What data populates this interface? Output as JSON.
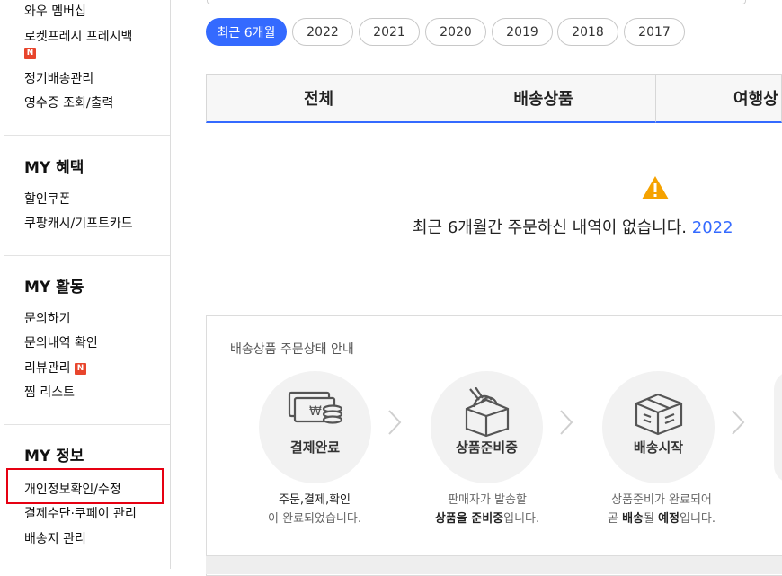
{
  "sidebar": {
    "group1": {
      "items": [
        "와우 멤버십",
        "로켓프레시 프레시백",
        "정기배송관리",
        "영수증 조회/출력"
      ]
    },
    "new_badge": "N",
    "benefits": {
      "title": "MY 혜택",
      "items": [
        "할인쿠폰",
        "쿠팡캐시/기프트카드"
      ]
    },
    "activity": {
      "title": "MY 활동",
      "items": [
        "문의하기",
        "문의내역 확인",
        "리뷰관리",
        "찜 리스트"
      ]
    },
    "info": {
      "title": "MY 정보",
      "items": [
        "개인정보확인/수정",
        "결제수단·쿠페이 관리",
        "배송지 관리"
      ]
    }
  },
  "periods": [
    "최근 6개월",
    "2022",
    "2021",
    "2020",
    "2019",
    "2018",
    "2017"
  ],
  "active_period": "최근 6개월",
  "tabs": [
    "전체",
    "배송상품",
    "여행상"
  ],
  "empty": {
    "message": "최근 6개월간 주문하신 내역이 없습니다.",
    "link": "2022"
  },
  "guide": {
    "title": "배송상품 주문상태 안내",
    "steps": [
      {
        "label": "결제완료",
        "icon": "payment-icon",
        "desc": [
          "주문,결제,확인",
          "이 완료되었습니다."
        ]
      },
      {
        "label": "상품준비중",
        "icon": "box-preparing-icon",
        "desc_line1": "판매자가 발송할",
        "desc_line2_strong": "상품을 준비중",
        "desc_line2_rest": "입니다."
      },
      {
        "label": "배송시작",
        "icon": "shipping-box-icon",
        "desc_line1": "상품준비가 완료되어",
        "desc_l2_a": "곧 ",
        "desc_l2_b": "배송",
        "desc_l2_c": "될 ",
        "desc_l2_d": "예정",
        "desc_l2_e": "입니다."
      }
    ]
  },
  "colors": {
    "accent": "#346aff",
    "highlight": "#e60012",
    "badge": "#e8452c",
    "warning": "#f5a200"
  }
}
